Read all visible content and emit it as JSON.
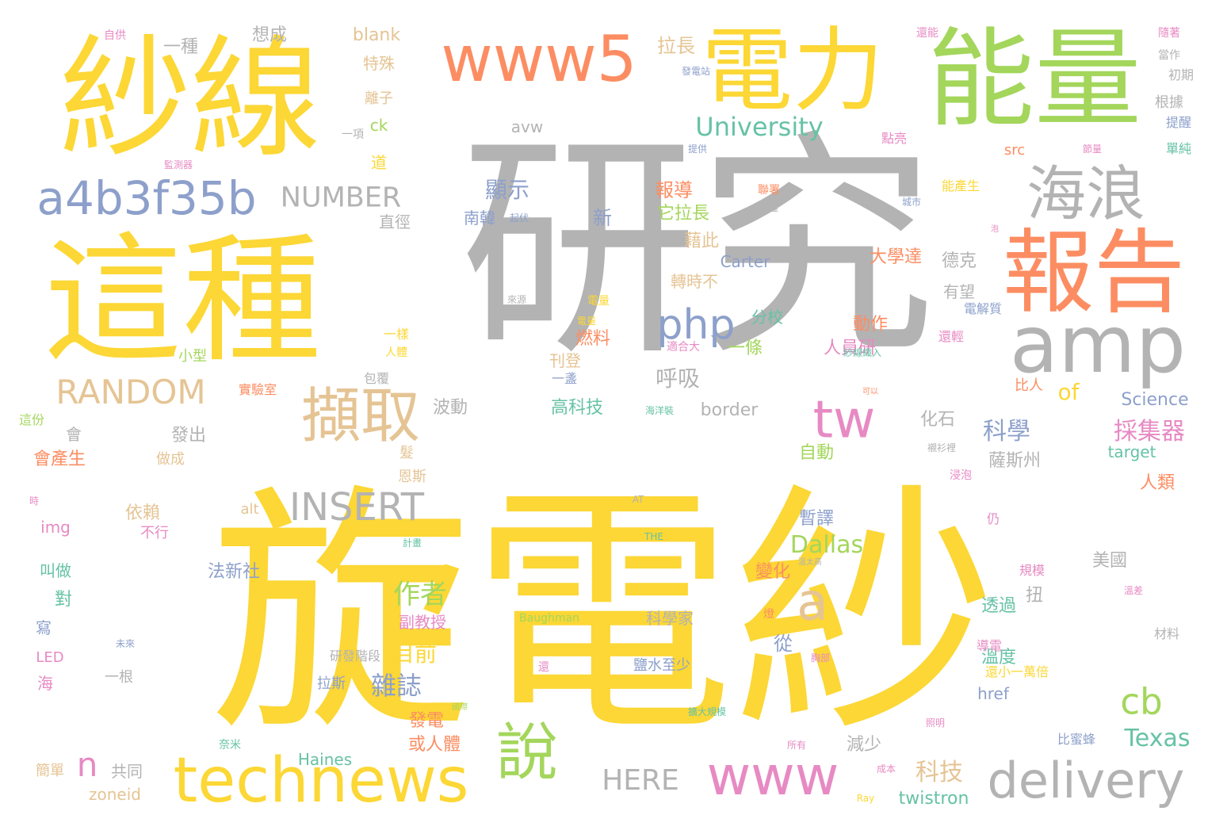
{
  "words": [
    {
      "text": "研究",
      "color": "gray"
    },
    {
      "text": "旋電紗",
      "color": "yellow"
    },
    {
      "text": "紗線",
      "color": "yellow"
    },
    {
      "text": "這種",
      "color": "yellow"
    },
    {
      "text": "能量",
      "color": "green"
    },
    {
      "text": "電力",
      "color": "yellow"
    },
    {
      "text": "www5",
      "color": "orange"
    },
    {
      "text": "報告",
      "color": "orange"
    },
    {
      "text": "海浪",
      "color": "gray"
    },
    {
      "text": "amp",
      "color": "gray"
    },
    {
      "text": "a4b3f35b",
      "color": "blue"
    },
    {
      "text": "擷取",
      "color": "tan"
    },
    {
      "text": "php",
      "color": "blue"
    },
    {
      "text": "tw",
      "color": "pink"
    },
    {
      "text": "technews",
      "color": "yellow"
    },
    {
      "text": "www",
      "color": "pink"
    },
    {
      "text": "delivery",
      "color": "gray"
    },
    {
      "text": "說",
      "color": "green"
    },
    {
      "text": "RANDOM",
      "color": "tan"
    },
    {
      "text": "INSERT",
      "color": "gray"
    },
    {
      "text": "NUMBER",
      "color": "gray"
    },
    {
      "text": "University",
      "color": "teal"
    },
    {
      "text": "a",
      "color": "tan"
    },
    {
      "text": "cb",
      "color": "green"
    },
    {
      "text": "n",
      "color": "pink"
    },
    {
      "text": "HERE",
      "color": "gray"
    },
    {
      "text": "Dallas",
      "color": "green"
    },
    {
      "text": "Texas",
      "color": "teal"
    },
    {
      "text": "科學",
      "color": "blue"
    },
    {
      "text": "採集器",
      "color": "pink"
    },
    {
      "text": "作者",
      "color": "green"
    },
    {
      "text": "雜誌",
      "color": "blue"
    },
    {
      "text": "科技",
      "color": "tan"
    },
    {
      "text": "顯示",
      "color": "blue"
    },
    {
      "text": "呼吸",
      "color": "gray"
    },
    {
      "text": "blank",
      "color": "tan"
    },
    {
      "text": "avw",
      "color": "gray"
    },
    {
      "text": "一種",
      "color": "gray"
    },
    {
      "text": "想成",
      "color": "gray"
    },
    {
      "text": "特殊",
      "color": "tan"
    },
    {
      "text": "拉長",
      "color": "tan"
    },
    {
      "text": "離子",
      "color": "tan"
    },
    {
      "text": "ck",
      "color": "green"
    },
    {
      "text": "一項",
      "color": "gray"
    },
    {
      "text": "道",
      "color": "yellow"
    },
    {
      "text": "直徑",
      "color": "gray"
    },
    {
      "text": "南韓",
      "color": "blue"
    },
    {
      "text": "新",
      "color": "blue"
    },
    {
      "text": "報導",
      "color": "orange"
    },
    {
      "text": "它拉長",
      "color": "green"
    },
    {
      "text": "藉此",
      "color": "tan"
    },
    {
      "text": "Carter",
      "color": "blue"
    },
    {
      "text": "轉時不",
      "color": "tan"
    },
    {
      "text": "燃料",
      "color": "orange"
    },
    {
      "text": "刊登",
      "color": "tan"
    },
    {
      "text": "分校",
      "color": "teal"
    },
    {
      "text": "一條",
      "color": "green"
    },
    {
      "text": "動作",
      "color": "orange"
    },
    {
      "text": "人員研",
      "color": "pink"
    },
    {
      "text": "比人",
      "color": "orange"
    },
    {
      "text": "of",
      "color": "yellow"
    },
    {
      "text": "高科技",
      "color": "teal"
    },
    {
      "text": "border",
      "color": "gray"
    },
    {
      "text": "波動",
      "color": "gray"
    },
    {
      "text": "發出",
      "color": "gray"
    },
    {
      "text": "化石",
      "color": "gray"
    },
    {
      "text": "自動",
      "color": "green"
    },
    {
      "text": "暫譯",
      "color": "blue"
    },
    {
      "text": "依賴",
      "color": "tan"
    },
    {
      "text": "法新社",
      "color": "blue"
    },
    {
      "text": "變化",
      "color": "orange"
    },
    {
      "text": "img",
      "color": "pink"
    },
    {
      "text": "alt",
      "color": "tan"
    },
    {
      "text": "叫做",
      "color": "teal"
    },
    {
      "text": "對",
      "color": "teal"
    },
    {
      "text": "副教授",
      "color": "pink"
    },
    {
      "text": "目前",
      "color": "yellow"
    },
    {
      "text": "從",
      "color": "blue"
    },
    {
      "text": "拉斯",
      "color": "blue"
    },
    {
      "text": "發電",
      "color": "orange"
    },
    {
      "text": "或人體",
      "color": "orange"
    },
    {
      "text": "減少",
      "color": "gray"
    },
    {
      "text": "Haines",
      "color": "teal"
    },
    {
      "text": "共同",
      "color": "gray"
    },
    {
      "text": "簡單",
      "color": "tan"
    },
    {
      "text": "zoneid",
      "color": "tan"
    },
    {
      "text": "twistron",
      "color": "teal"
    },
    {
      "text": "LED",
      "color": "pink"
    },
    {
      "text": "海",
      "color": "pink"
    },
    {
      "text": "寫",
      "color": "blue"
    },
    {
      "text": "溫度",
      "color": "teal"
    },
    {
      "text": "透過",
      "color": "teal"
    },
    {
      "text": "扭",
      "color": "gray"
    },
    {
      "text": "美國",
      "color": "gray"
    },
    {
      "text": "href",
      "color": "blue"
    },
    {
      "text": "薩斯州",
      "color": "gray"
    },
    {
      "text": "人類",
      "color": "orange"
    },
    {
      "text": "target",
      "color": "teal"
    },
    {
      "text": "Science",
      "color": "blue"
    },
    {
      "text": "德克",
      "color": "gray"
    },
    {
      "text": "大學達",
      "color": "orange"
    },
    {
      "text": "有望",
      "color": "gray"
    },
    {
      "text": "src",
      "color": "orange"
    },
    {
      "text": "根據",
      "color": "gray"
    },
    {
      "text": "會產生",
      "color": "orange"
    },
    {
      "text": "會",
      "color": "gray"
    },
    {
      "text": "恩斯",
      "color": "tan"
    },
    {
      "text": "髮",
      "color": "tan"
    },
    {
      "text": "科學家",
      "color": "gray"
    },
    {
      "text": "研發階段",
      "color": "gray"
    },
    {
      "text": "鹽水至少",
      "color": "blue"
    },
    {
      "text": "Baughman",
      "color": "green"
    },
    {
      "text": "實驗室",
      "color": "orange"
    },
    {
      "text": "小型",
      "color": "green"
    },
    {
      "text": "這份",
      "color": "green"
    },
    {
      "text": "做成",
      "color": "tan"
    },
    {
      "text": "不行",
      "color": "pink"
    },
    {
      "text": "一根",
      "color": "gray"
    },
    {
      "text": "包覆",
      "color": "gray"
    },
    {
      "text": "一樣",
      "color": "yellow"
    },
    {
      "text": "人體",
      "color": "yellow"
    },
    {
      "text": "一盞",
      "color": "blue"
    },
    {
      "text": "適合大",
      "color": "pink"
    },
    {
      "text": "電量",
      "color": "yellow"
    },
    {
      "text": "還能",
      "color": "pink"
    },
    {
      "text": "能產生",
      "color": "yellow"
    },
    {
      "text": "點亮",
      "color": "pink"
    },
    {
      "text": "城市",
      "color": "blue"
    },
    {
      "text": "當作",
      "color": "gray"
    },
    {
      "text": "初期",
      "color": "gray"
    },
    {
      "text": "提醒",
      "color": "blue"
    },
    {
      "text": "單純",
      "color": "teal"
    },
    {
      "text": "電解質",
      "color": "blue"
    },
    {
      "text": "還輕",
      "color": "pink"
    },
    {
      "text": "仍",
      "color": "pink"
    },
    {
      "text": "規模",
      "color": "pink"
    },
    {
      "text": "導電",
      "color": "pink"
    },
    {
      "text": "還小一萬倍",
      "color": "yellow"
    },
    {
      "text": "材料",
      "color": "gray"
    },
    {
      "text": "比蜜蜂",
      "color": "blue"
    },
    {
      "text": "自供",
      "color": "pink"
    },
    {
      "text": "隨著",
      "color": "pink"
    },
    {
      "text": "發電站",
      "color": "blue"
    },
    {
      "text": "監測器",
      "color": "pink"
    },
    {
      "text": "提供",
      "color": "blue"
    },
    {
      "text": "聯署",
      "color": "orange"
    },
    {
      "text": "不僅",
      "color": "gray"
    },
    {
      "text": "起伏",
      "color": "blue"
    },
    {
      "text": "未來",
      "color": "blue"
    },
    {
      "text": "來源",
      "color": "gray"
    },
    {
      "text": "海洋裝",
      "color": "teal"
    },
    {
      "text": "紗線織入",
      "color": "teal"
    },
    {
      "text": "襯衫裡",
      "color": "gray"
    },
    {
      "text": "AT",
      "color": "gray"
    },
    {
      "text": "THE",
      "color": "teal"
    },
    {
      "text": "溫差",
      "color": "pink"
    },
    {
      "text": "計畫",
      "color": "teal"
    },
    {
      "text": "擴大規模",
      "color": "teal"
    },
    {
      "text": "奈米",
      "color": "teal"
    },
    {
      "text": "照明",
      "color": "pink"
    },
    {
      "text": "所有",
      "color": "pink"
    },
    {
      "text": "成本",
      "color": "pink"
    },
    {
      "text": "Ray",
      "color": "yellow"
    },
    {
      "text": "國際",
      "color": "green"
    },
    {
      "text": "還",
      "color": "pink"
    },
    {
      "text": "胸部",
      "color": "pink"
    },
    {
      "text": "燈",
      "color": "orange"
    },
    {
      "text": "溫太高",
      "color": "gray"
    },
    {
      "text": "時",
      "color": "pink"
    },
    {
      "text": "電量",
      "color": "yellow"
    },
    {
      "text": "泡",
      "color": "pink"
    },
    {
      "text": "浸泡",
      "color": "pink"
    },
    {
      "text": "可以",
      "color": "orange"
    },
    {
      "text": "節量",
      "color": "pink"
    }
  ]
}
